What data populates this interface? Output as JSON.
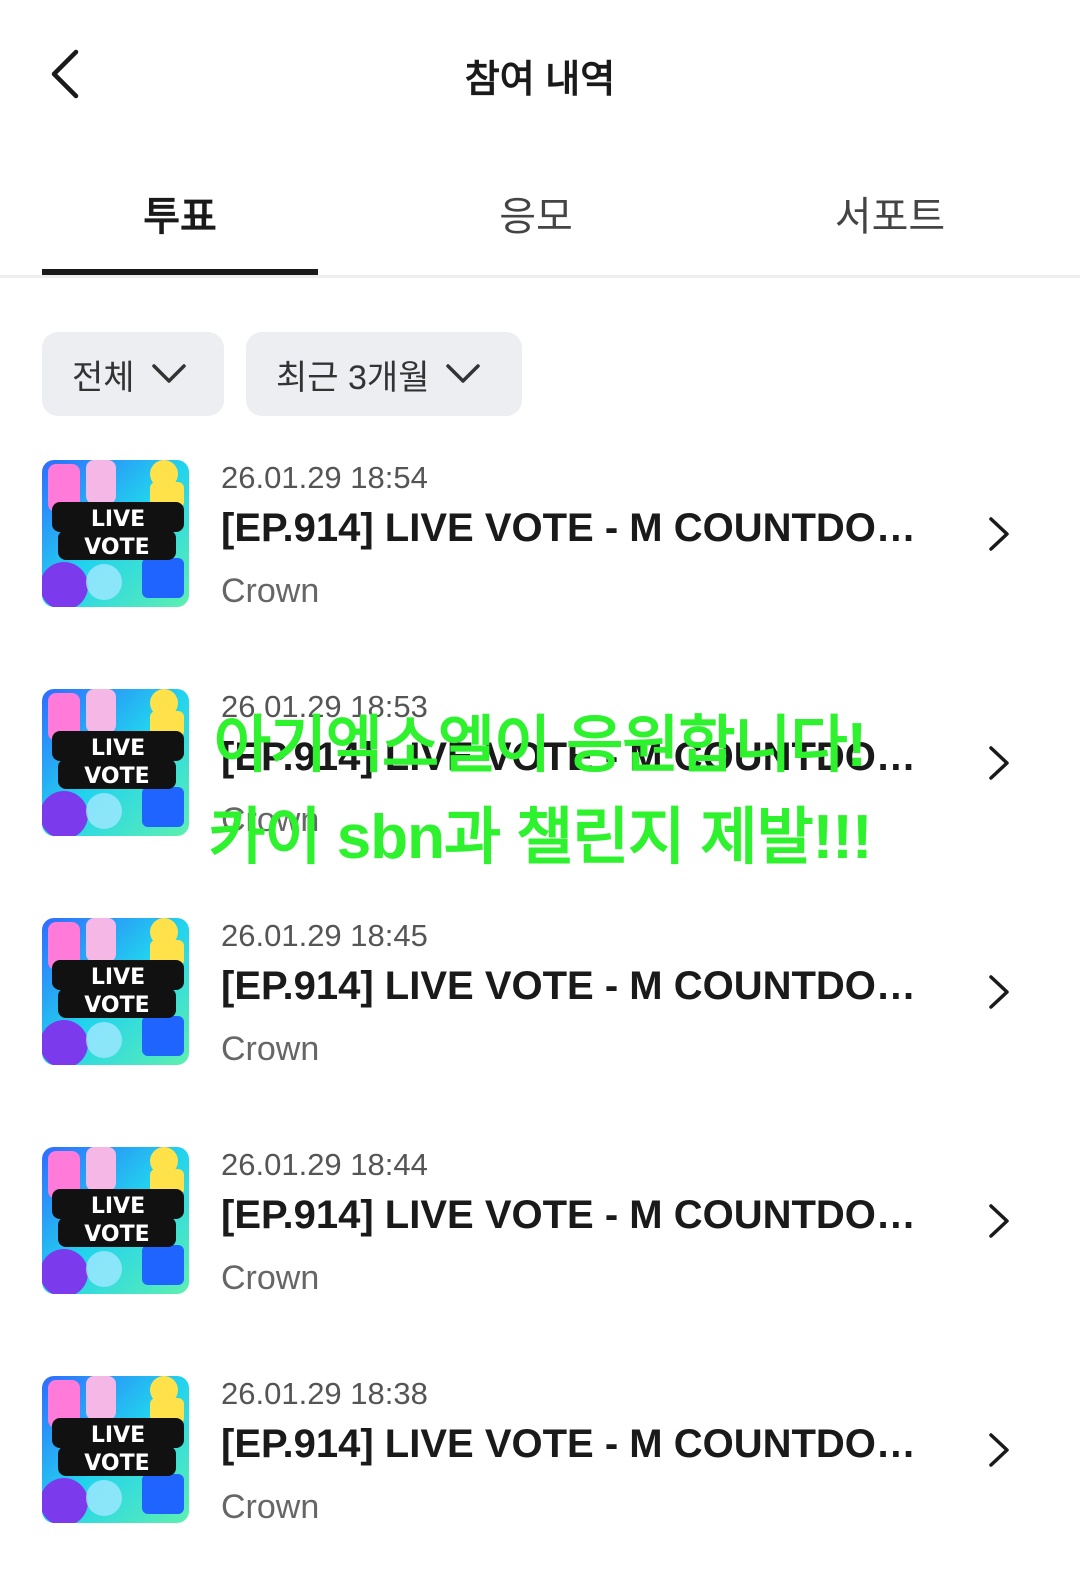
{
  "header": {
    "title": "참여 내역"
  },
  "tabs": [
    {
      "label": "투표",
      "active": true
    },
    {
      "label": "응모",
      "active": false
    },
    {
      "label": "서포트",
      "active": false
    }
  ],
  "filters": {
    "category": "전체",
    "period": "최근 3개월"
  },
  "items": [
    {
      "date": "26.01.29 18:54",
      "title": "[EP.914] LIVE VOTE - M COUNTDOWN",
      "sub": "Crown",
      "thumb_text": [
        "LIVE",
        "VOTE"
      ]
    },
    {
      "date": "26.01.29 18:53",
      "title": "[EP.914] LIVE VOTE - M COUNTDOWN",
      "sub": "Crown",
      "thumb_text": [
        "LIVE",
        "VOTE"
      ]
    },
    {
      "date": "26.01.29 18:45",
      "title": "[EP.914] LIVE VOTE - M COUNTDOWN",
      "sub": "Crown",
      "thumb_text": [
        "LIVE",
        "VOTE"
      ]
    },
    {
      "date": "26.01.29 18:44",
      "title": "[EP.914] LIVE VOTE - M COUNTDOWN",
      "sub": "Crown",
      "thumb_text": [
        "LIVE",
        "VOTE"
      ]
    },
    {
      "date": "26.01.29 18:38",
      "title": "[EP.914] LIVE VOTE - M COUNTDOWN",
      "sub": "Crown",
      "thumb_text": [
        "LIVE",
        "VOTE"
      ]
    }
  ],
  "overlay": {
    "line1": "아기엑소엘이 응원합니다!",
    "line2": "카이 sbn과 챌린지 제발!!!",
    "color": "#2ff22f"
  },
  "icons": {
    "back": "chevron-left-icon",
    "dropdown": "chevron-down-icon",
    "row": "chevron-right-icon"
  }
}
